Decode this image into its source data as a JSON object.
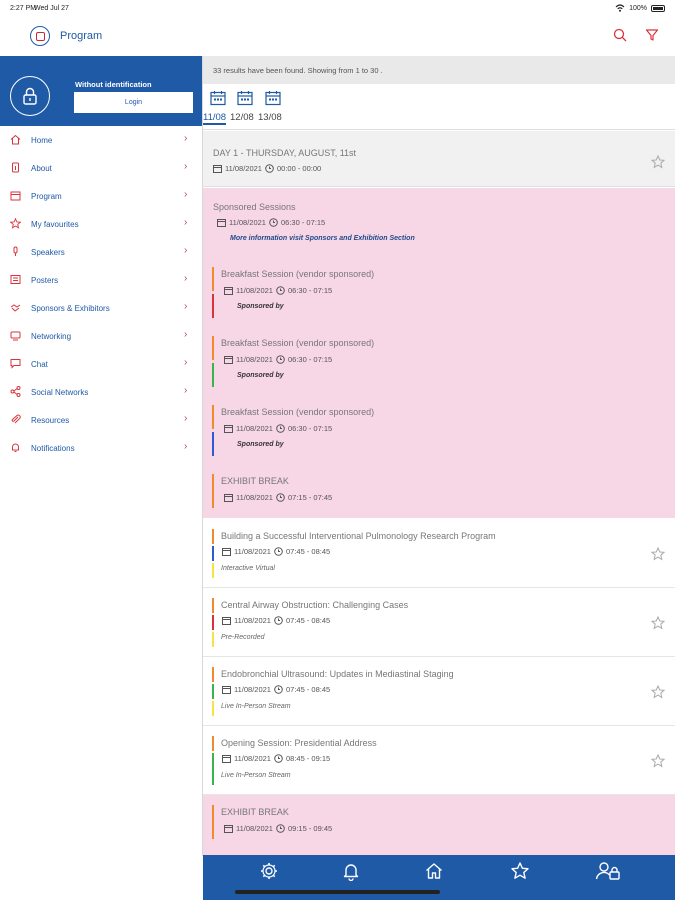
{
  "status": {
    "time": "2:27 PM",
    "date": "Wed Jul 27",
    "battery": "100%"
  },
  "header": {
    "title": "Program"
  },
  "sidebar": {
    "user_label": "Without identification",
    "login_label": "Login",
    "items": [
      {
        "label": "Home",
        "icon": "home-icon"
      },
      {
        "label": "About",
        "icon": "info-icon"
      },
      {
        "label": "Program",
        "icon": "calendar-icon"
      },
      {
        "label": "My favourites",
        "icon": "star-icon"
      },
      {
        "label": "Speakers",
        "icon": "microphone-icon"
      },
      {
        "label": "Posters",
        "icon": "poster-icon"
      },
      {
        "label": "Sponsors & Exhibitors",
        "icon": "handshake-icon"
      },
      {
        "label": "Networking",
        "icon": "networking-icon"
      },
      {
        "label": "Chat",
        "icon": "chat-icon"
      },
      {
        "label": "Social Networks",
        "icon": "share-icon"
      },
      {
        "label": "Resources",
        "icon": "paperclip-icon"
      },
      {
        "label": "Notifications",
        "icon": "bell-icon"
      }
    ]
  },
  "results_text": "33 results have been found. Showing from 1 to 30 .",
  "dates": [
    "11/08",
    "12/08",
    "13/08"
  ],
  "day": {
    "title": "DAY 1 - THURSDAY, AUGUST, 11st",
    "date": "11/08/2021",
    "time": "00:00 - 00:00"
  },
  "sponsored": {
    "title": "Sponsored Sessions",
    "date": "11/08/2021",
    "time": "06:30 - 07:15",
    "info": "More information visit Sponsors and Exhibition Section",
    "sessions": [
      {
        "title": "Breakfast Session (vendor sponsored)",
        "date": "11/08/2021",
        "time": "06:30 - 07:15",
        "sub": "Sponsored by",
        "color": "#d9343c"
      },
      {
        "title": "Breakfast Session (vendor sponsored)",
        "date": "11/08/2021",
        "time": "06:30 - 07:15",
        "sub": "Sponsored by",
        "color": "#3bb54a"
      },
      {
        "title": "Breakfast Session (vendor sponsored)",
        "date": "11/08/2021",
        "time": "06:30 - 07:15",
        "sub": "Sponsored by",
        "color": "#2c5bd4"
      },
      {
        "title": "EXHIBIT BREAK",
        "date": "11/08/2021",
        "time": "07:15 - 07:45",
        "sub": "",
        "color": "#f08a2c"
      }
    ]
  },
  "sessions": [
    {
      "title": "Building a Successful Interventional Pulmonology Research Program",
      "date": "11/08/2021",
      "time": "07:45 - 08:45",
      "type": "Interactive Virtual",
      "color2": "#2c5bd4",
      "color3": "#f4e542"
    },
    {
      "title": "Central Airway Obstruction: Challenging Cases",
      "date": "11/08/2021",
      "time": "07:45 - 08:45",
      "type": "Pre-Recorded",
      "color2": "#d9343c",
      "color3": "#f4e542"
    },
    {
      "title": "Endobronchial Ultrasound: Updates in Mediastinal Staging",
      "date": "11/08/2021",
      "time": "07:45 - 08:45",
      "type": "Live In-Person Stream",
      "color2": "#3bb54a",
      "color3": "#f4e542"
    },
    {
      "title": "Opening Session: Presidential Address",
      "date": "11/08/2021",
      "time": "08:45 - 09:15",
      "type": "Live In-Person Stream",
      "color2": "#3bb54a",
      "color3": ""
    }
  ],
  "exhibit_break2": {
    "title": "EXHIBIT BREAK",
    "date": "11/08/2021",
    "time": "09:15 - 09:45"
  },
  "colors": {
    "brand_blue": "#1f5aa6",
    "accent_red": "#d9343c",
    "pink_bg": "#f7d6e6",
    "orange_bar": "#f08a2c"
  },
  "bottom_nav": [
    "settings-icon",
    "bell-icon",
    "home-icon",
    "star-icon",
    "user-lock-icon"
  ]
}
